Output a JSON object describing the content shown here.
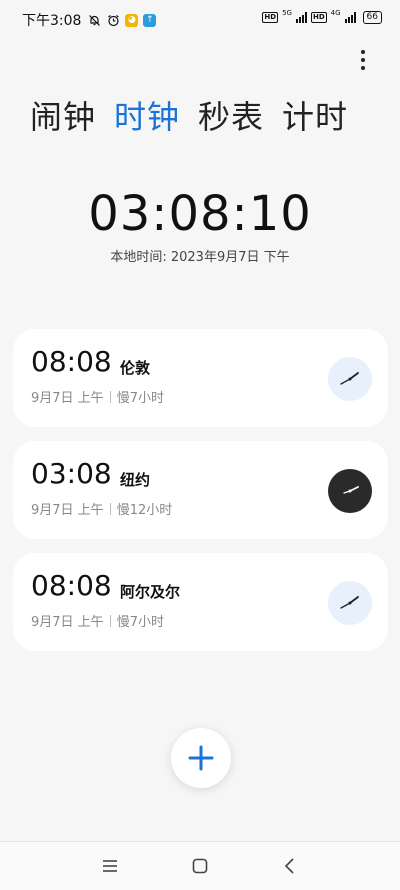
{
  "status_bar": {
    "time": "下午3:08",
    "net_1": "5G",
    "net_2": "4G",
    "hd": "HD",
    "battery": "66"
  },
  "tabs": [
    {
      "label": "闹钟"
    },
    {
      "label": "时钟"
    },
    {
      "label": "秒表"
    },
    {
      "label": "计时"
    }
  ],
  "active_tab_index": 1,
  "main_clock": {
    "time": "03:08:10",
    "date_label": "本地时间: 2023年9月7日 下午"
  },
  "world_clocks": [
    {
      "time": "08:08",
      "city": "伦敦",
      "date": "9月7日 上午",
      "offset": "慢7小时",
      "dial": "light"
    },
    {
      "time": "03:08",
      "city": "纽约",
      "date": "9月7日 上午",
      "offset": "慢12小时",
      "dial": "dark"
    },
    {
      "time": "08:08",
      "city": "阿尔及尔",
      "date": "9月7日 上午",
      "offset": "慢7小时",
      "dial": "light"
    }
  ],
  "colors": {
    "accent": "#1a73d6",
    "background": "#f6f6f6",
    "card": "#ffffff",
    "muted_text": "#888888"
  }
}
